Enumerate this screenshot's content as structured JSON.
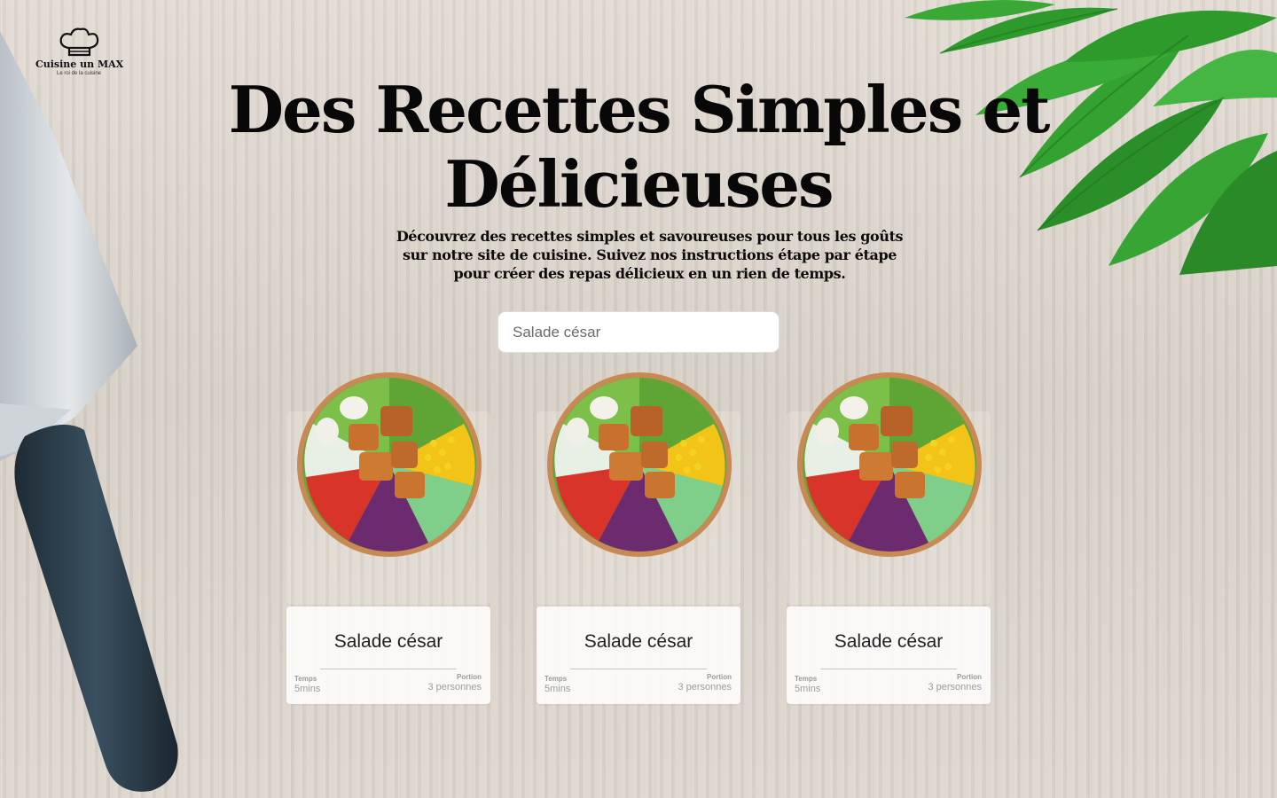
{
  "brand": {
    "name": "Cuisine un MAX",
    "tagline": "Le roi de la cuisine",
    "logo_icon": "chef-hat-icon"
  },
  "hero": {
    "title": "Des Recettes Simples et Délicieuses",
    "subtitle": "Découvrez des recettes simples et savoureuses pour tous les goûts sur notre site de cuisine. Suivez nos instructions étape par étape pour créer des repas délicieux en un rien de temps."
  },
  "search": {
    "placeholder": "Salade césar",
    "value": ""
  },
  "recipes": [
    {
      "title": "Salade césar",
      "time_label": "Temps",
      "time_value": "5mins",
      "portion_label": "Portion",
      "portion_value": "3 personnes"
    },
    {
      "title": "Salade césar",
      "time_label": "Temps",
      "time_value": "5mins",
      "portion_label": "Portion",
      "portion_value": "3 personnes"
    },
    {
      "title": "Salade césar",
      "time_label": "Temps",
      "time_value": "5mins",
      "portion_label": "Portion",
      "portion_value": "3 personnes"
    }
  ],
  "colors": {
    "background": "#d9d2c9",
    "text": "#080808",
    "card": "#ffffff",
    "knife_handle": "#2d3f4c",
    "herbs": "#2e9a2c"
  }
}
